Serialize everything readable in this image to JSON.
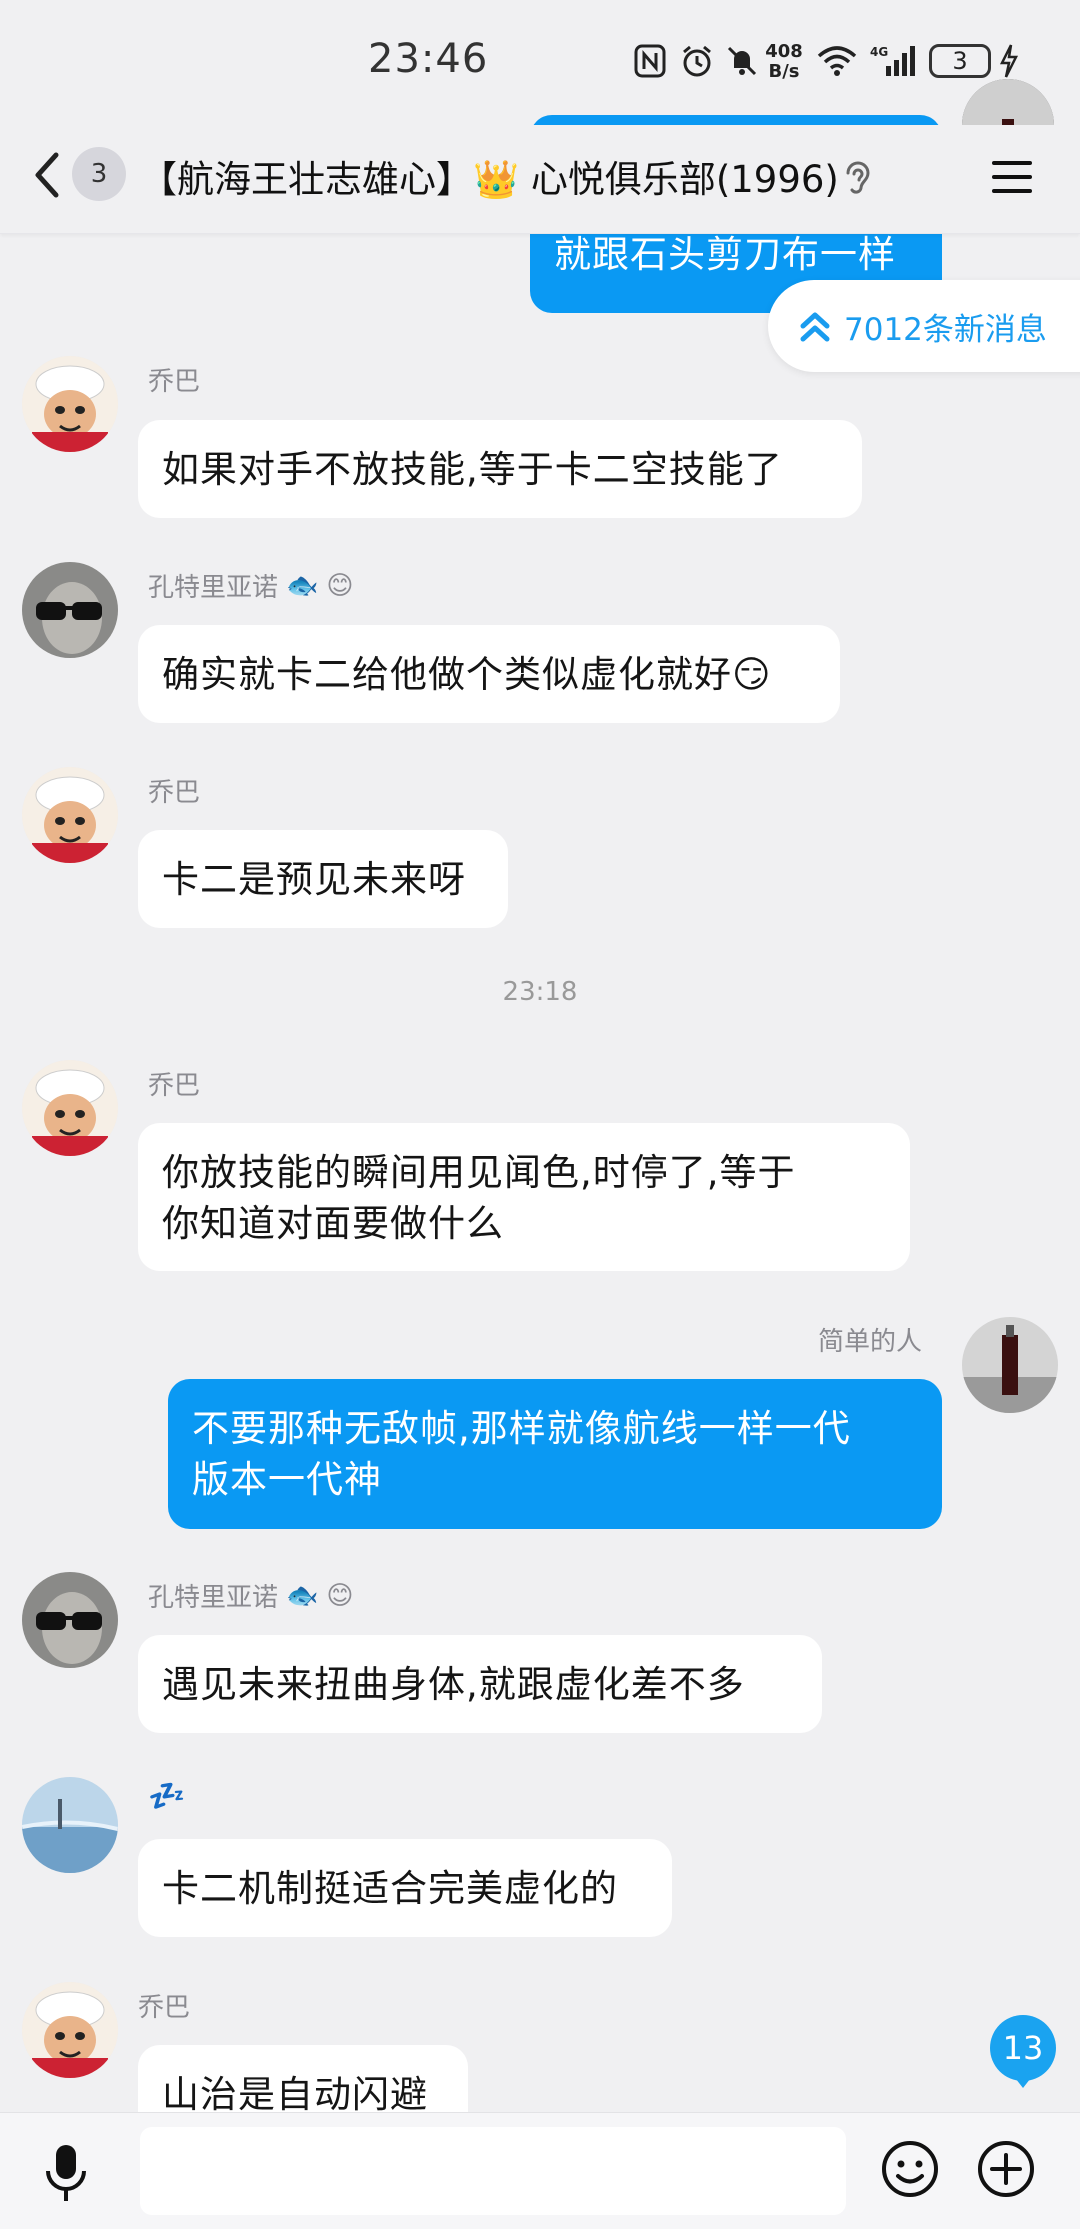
{
  "status_bar": {
    "time": "23:46",
    "net_speed_top": "408",
    "net_speed_bottom": "B/s",
    "battery": "3",
    "icons": [
      "nfc-icon",
      "alarm-icon",
      "mute-icon",
      "wifi-icon",
      "signal-icon",
      "battery-icon",
      "charging-icon"
    ]
  },
  "header": {
    "unread_count": "3",
    "title": "【航海王壮志雄心】👑 心悦俱乐部(1996)"
  },
  "new_messages_pill": "7012条新消息",
  "messages": [
    {
      "side": "right",
      "text": "就跟石头剪刀布一样"
    },
    {
      "sender": "乔巴",
      "text": "如果对手不放技能,等于卡二空技能了"
    },
    {
      "sender": "孔特里亚诺",
      "text": "确实就卡二给他做个类似虚化就好😏"
    },
    {
      "sender": "乔巴",
      "text": "卡二是预见未来呀"
    },
    {
      "sender": "乔巴",
      "text": "你放技能的瞬间用见闻色,时停了,等于\n你知道对面要做什么"
    },
    {
      "sender": "简单的人",
      "text": "不要那种无敌帧,那样就像航线一样一代\n版本一代神"
    },
    {
      "sender": "孔特里亚诺",
      "text": "遇见未来扭曲身体,就跟虚化差不多"
    },
    {
      "sender": "💤",
      "text": "卡二机制挺适合完美虚化的"
    },
    {
      "sender": "乔巴",
      "text": "山治是自动闪避"
    }
  ],
  "timestamp": "23:18",
  "badges": {
    "fish": "🐟",
    "face": "😊"
  },
  "scroll_unread": "13",
  "colors": {
    "accent": "#0a99f3",
    "background": "#f0f0f2"
  }
}
